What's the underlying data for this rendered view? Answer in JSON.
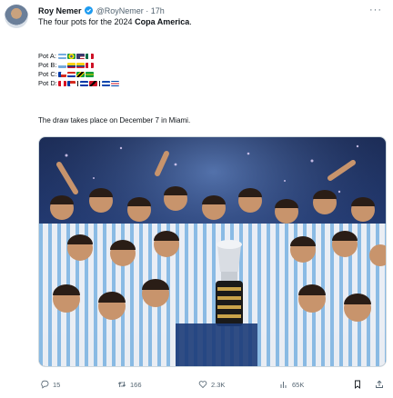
{
  "author": {
    "name": "Roy Nemer",
    "handle": "@RoyNemer",
    "separator": "·",
    "time": "17h"
  },
  "icons": {
    "avatar": "avatar",
    "verified": "verified-badge-icon",
    "more": "more-options-icon",
    "reply": "reply-icon",
    "retweet": "retweet-icon",
    "like": "heart-icon",
    "views": "views-chart-icon",
    "bookmark": "bookmark-icon",
    "share": "share-icon"
  },
  "tweet": {
    "text_prefix": "The four pots for the 2024 ",
    "text_bold": "Copa America",
    "text_suffix": ".",
    "draw_note": "The draw takes place on December 7 in Miami."
  },
  "pots": [
    {
      "label": "Pot A:",
      "flags": [
        "#74acdf",
        "#1e9a45",
        "#3c5aa6",
        "#e03a3e"
      ]
    },
    {
      "label": "Pot B:",
      "flags": [
        "#75aadb",
        "#fcd116",
        "#ce1126",
        "#d52b1e"
      ]
    },
    {
      "label": "Pot C:",
      "flags": [
        "#002b7f",
        "#c8102e",
        "#0033a0",
        "#009b3a"
      ]
    },
    {
      "label": "Pot D:",
      "flags": [
        "#d91023",
        "#00247d",
        "#002868",
        "#cf142b",
        "#0f47af",
        "#d52b1e"
      ]
    }
  ],
  "colors": {
    "text": "#0f1419",
    "secondary": "#536471",
    "verified": "#1d9bf0",
    "bookmark_active": "#0f1419"
  },
  "actions": {
    "replies": "15",
    "retweets": "166",
    "likes": "2.3K",
    "views": "65K"
  }
}
